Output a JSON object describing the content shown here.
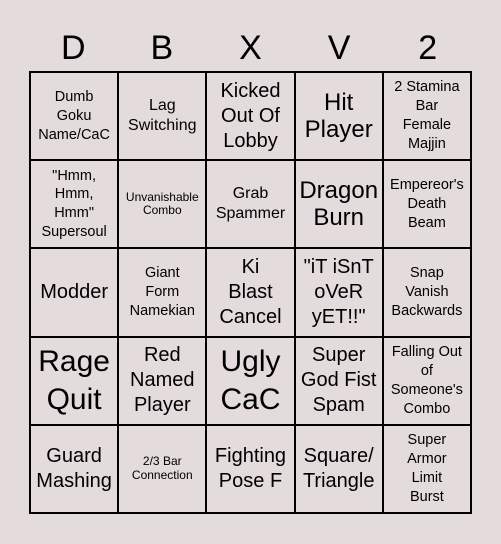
{
  "header": [
    "D",
    "B",
    "X",
    "V",
    "2"
  ],
  "cells": [
    {
      "text": "Dumb\nGoku\nName/CaC",
      "size": "s2"
    },
    {
      "text": "Lag\nSwitching",
      "size": "s3"
    },
    {
      "text": "Kicked\nOut Of\nLobby",
      "size": "s4"
    },
    {
      "text": "Hit\nPlayer",
      "size": "s5"
    },
    {
      "text": "2 Stamina\nBar\nFemale\nMajjin",
      "size": "s2"
    },
    {
      "text": "\"Hmm,\nHmm,\nHmm\"\nSupersoul",
      "size": "s2"
    },
    {
      "text": "Unvanishable\nCombo",
      "size": "s1"
    },
    {
      "text": "Grab\nSpammer",
      "size": "s3"
    },
    {
      "text": "Dragon\nBurn",
      "size": "s5"
    },
    {
      "text": "Empereor's\nDeath\nBeam",
      "size": "s2"
    },
    {
      "text": "Modder",
      "size": "s4"
    },
    {
      "text": "Giant\nForm\nNamekian",
      "size": "s2"
    },
    {
      "text": "Ki\nBlast\nCancel",
      "size": "s4"
    },
    {
      "text": "\"iT iSnT\noVeR\nyET!!\"",
      "size": "s4"
    },
    {
      "text": "Snap\nVanish\nBackwards",
      "size": "s2"
    },
    {
      "text": "Rage\nQuit",
      "size": "s6"
    },
    {
      "text": "Red\nNamed\nPlayer",
      "size": "s4"
    },
    {
      "text": "Ugly\nCaC",
      "size": "s6"
    },
    {
      "text": "Super\nGod Fist\nSpam",
      "size": "s4"
    },
    {
      "text": "Falling Out\nof\nSomeone's\nCombo",
      "size": "s2"
    },
    {
      "text": "Guard\nMashing",
      "size": "s4"
    },
    {
      "text": "2/3 Bar\nConnection",
      "size": "s1"
    },
    {
      "text": "Fighting\nPose F",
      "size": "s4"
    },
    {
      "text": "Square/\nTriangle",
      "size": "s4"
    },
    {
      "text": "Super\nArmor\nLimit\nBurst",
      "size": "s2"
    }
  ]
}
